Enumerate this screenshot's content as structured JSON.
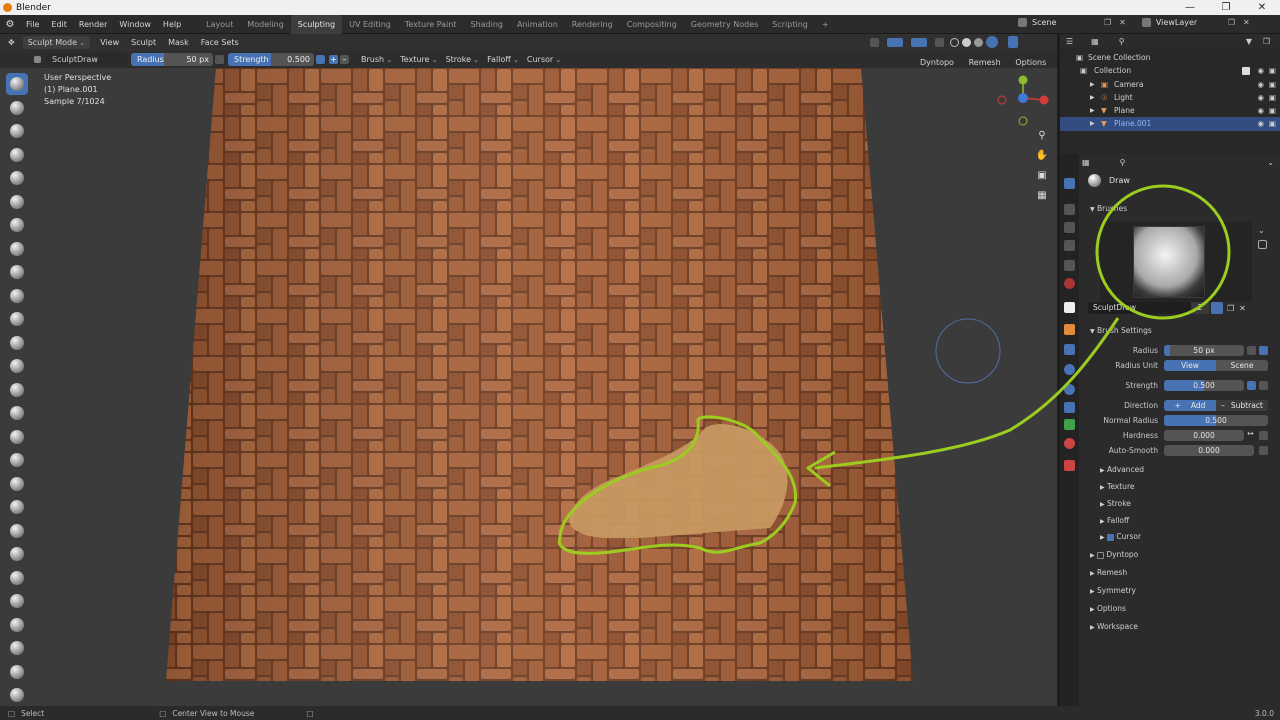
{
  "app": {
    "title": "Blender",
    "version": "3.0.0"
  },
  "menu": [
    "File",
    "Edit",
    "Render",
    "Window",
    "Help"
  ],
  "workspaces": [
    "Layout",
    "Modeling",
    "Sculpting",
    "UV Editing",
    "Texture Paint",
    "Shading",
    "Animation",
    "Rendering",
    "Compositing",
    "Geometry Nodes",
    "Scripting"
  ],
  "active_workspace": "Sculpting",
  "scene": {
    "name": "Scene",
    "view_layer": "ViewLayer"
  },
  "header": {
    "mode": "Sculpt Mode",
    "menus": [
      "View",
      "Sculpt",
      "Mask",
      "Face Sets"
    ]
  },
  "tool_settings": {
    "brush_name": "SculptDraw",
    "radius_label": "Radius",
    "radius_value": "50 px",
    "strength_label": "Strength",
    "strength_value": "0.500",
    "dropdowns": [
      "Brush",
      "Texture",
      "Stroke",
      "Falloff",
      "Cursor"
    ],
    "axes": [
      "X",
      "Y",
      "Z"
    ],
    "right_menus": [
      "Dyntopo",
      "Remesh",
      "Options"
    ]
  },
  "viewport": {
    "perspective": "User Perspective",
    "object": "(1) Plane.001",
    "sample": "Sample 7/1024"
  },
  "outliner": {
    "root": "Scene Collection",
    "collection": "Collection",
    "items": [
      {
        "name": "Camera",
        "icon": "camera-icon"
      },
      {
        "name": "Light",
        "icon": "light-icon"
      },
      {
        "name": "Plane",
        "icon": "mesh-icon"
      },
      {
        "name": "Plane.001",
        "icon": "mesh-icon"
      }
    ]
  },
  "properties": {
    "tool_name": "Draw",
    "brushes_label": "Brushes",
    "brush_field": "SculptDraw",
    "brush_users": "2",
    "brush_settings_label": "Brush Settings",
    "radius_label": "Radius",
    "radius_value": "50 px",
    "radius_unit_label": "Radius Unit",
    "radius_unit_view": "View",
    "radius_unit_scene": "Scene",
    "strength_label": "Strength",
    "strength_value": "0.500",
    "direction_label": "Direction",
    "direction_add": "Add",
    "direction_subtract": "Subtract",
    "normal_radius_label": "Normal Radius",
    "normal_radius_value": "0.500",
    "hardness_label": "Hardness",
    "hardness_value": "0.000",
    "autosmooth_label": "Auto-Smooth",
    "autosmooth_value": "0.000",
    "subpanels": [
      "Advanced",
      "Texture",
      "Stroke",
      "Falloff",
      "Cursor"
    ],
    "panels": [
      "Dyntopo",
      "Remesh",
      "Symmetry",
      "Options",
      "Workspace"
    ]
  },
  "status": {
    "select": "Select",
    "center": "Center View to Mouse",
    "version": "3.0.0"
  },
  "colors": {
    "accent": "#4772b3",
    "highlight": "#9ccc1f",
    "brick": "#9b5a33"
  }
}
